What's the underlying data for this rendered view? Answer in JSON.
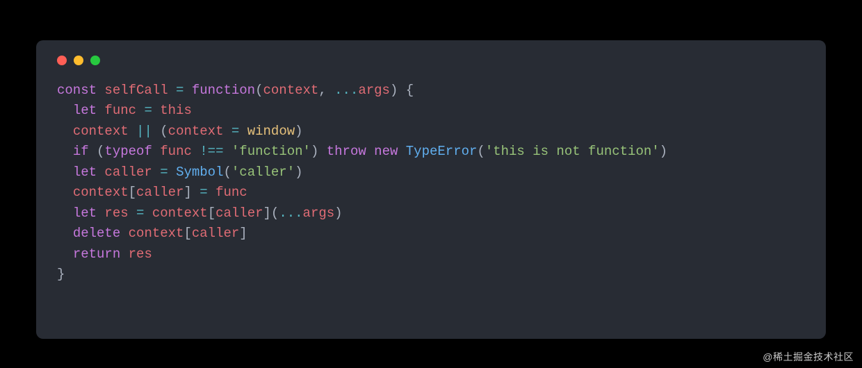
{
  "watermark": "@稀土掘金技术社区",
  "window": {
    "traffic": [
      "close",
      "minimize",
      "zoom"
    ]
  },
  "code": {
    "language": "javascript",
    "tokens": [
      [
        {
          "t": "const ",
          "c": "kw"
        },
        {
          "t": "selfCall",
          "c": "var"
        },
        {
          "t": " ",
          "c": "punc"
        },
        {
          "t": "=",
          "c": "op"
        },
        {
          "t": " ",
          "c": "punc"
        },
        {
          "t": "function",
          "c": "kw"
        },
        {
          "t": "(",
          "c": "punc"
        },
        {
          "t": "context",
          "c": "var"
        },
        {
          "t": ", ",
          "c": "punc"
        },
        {
          "t": "...",
          "c": "op"
        },
        {
          "t": "args",
          "c": "var"
        },
        {
          "t": ") {",
          "c": "punc"
        }
      ],
      [
        {
          "t": "  ",
          "c": "punc"
        },
        {
          "t": "let ",
          "c": "kw"
        },
        {
          "t": "func",
          "c": "var"
        },
        {
          "t": " ",
          "c": "punc"
        },
        {
          "t": "=",
          "c": "op"
        },
        {
          "t": " ",
          "c": "punc"
        },
        {
          "t": "this",
          "c": "var"
        }
      ],
      [
        {
          "t": "  ",
          "c": "punc"
        },
        {
          "t": "context",
          "c": "var"
        },
        {
          "t": " ",
          "c": "punc"
        },
        {
          "t": "||",
          "c": "op"
        },
        {
          "t": " (",
          "c": "punc"
        },
        {
          "t": "context",
          "c": "var"
        },
        {
          "t": " ",
          "c": "punc"
        },
        {
          "t": "=",
          "c": "op"
        },
        {
          "t": " ",
          "c": "punc"
        },
        {
          "t": "window",
          "c": "builtin"
        },
        {
          "t": ")",
          "c": "punc"
        }
      ],
      [
        {
          "t": "  ",
          "c": "punc"
        },
        {
          "t": "if ",
          "c": "kw"
        },
        {
          "t": "(",
          "c": "punc"
        },
        {
          "t": "typeof ",
          "c": "kw"
        },
        {
          "t": "func",
          "c": "var"
        },
        {
          "t": " ",
          "c": "punc"
        },
        {
          "t": "!==",
          "c": "op"
        },
        {
          "t": " ",
          "c": "punc"
        },
        {
          "t": "'function'",
          "c": "str"
        },
        {
          "t": ") ",
          "c": "punc"
        },
        {
          "t": "throw ",
          "c": "kw"
        },
        {
          "t": "new ",
          "c": "kw"
        },
        {
          "t": "TypeError",
          "c": "fn"
        },
        {
          "t": "(",
          "c": "punc"
        },
        {
          "t": "'this is not function'",
          "c": "str"
        },
        {
          "t": ")",
          "c": "punc"
        }
      ],
      [
        {
          "t": "  ",
          "c": "punc"
        },
        {
          "t": "let ",
          "c": "kw"
        },
        {
          "t": "caller",
          "c": "var"
        },
        {
          "t": " ",
          "c": "punc"
        },
        {
          "t": "=",
          "c": "op"
        },
        {
          "t": " ",
          "c": "punc"
        },
        {
          "t": "Symbol",
          "c": "fn"
        },
        {
          "t": "(",
          "c": "punc"
        },
        {
          "t": "'caller'",
          "c": "str"
        },
        {
          "t": ")",
          "c": "punc"
        }
      ],
      [
        {
          "t": "  ",
          "c": "punc"
        },
        {
          "t": "context",
          "c": "var"
        },
        {
          "t": "[",
          "c": "punc"
        },
        {
          "t": "caller",
          "c": "var"
        },
        {
          "t": "] ",
          "c": "punc"
        },
        {
          "t": "=",
          "c": "op"
        },
        {
          "t": " ",
          "c": "punc"
        },
        {
          "t": "func",
          "c": "var"
        }
      ],
      [
        {
          "t": "  ",
          "c": "punc"
        },
        {
          "t": "let ",
          "c": "kw"
        },
        {
          "t": "res",
          "c": "var"
        },
        {
          "t": " ",
          "c": "punc"
        },
        {
          "t": "=",
          "c": "op"
        },
        {
          "t": " ",
          "c": "punc"
        },
        {
          "t": "context",
          "c": "var"
        },
        {
          "t": "[",
          "c": "punc"
        },
        {
          "t": "caller",
          "c": "var"
        },
        {
          "t": "](",
          "c": "punc"
        },
        {
          "t": "...",
          "c": "op"
        },
        {
          "t": "args",
          "c": "var"
        },
        {
          "t": ")",
          "c": "punc"
        }
      ],
      [
        {
          "t": "  ",
          "c": "punc"
        },
        {
          "t": "delete ",
          "c": "kw"
        },
        {
          "t": "context",
          "c": "var"
        },
        {
          "t": "[",
          "c": "punc"
        },
        {
          "t": "caller",
          "c": "var"
        },
        {
          "t": "]",
          "c": "punc"
        }
      ],
      [
        {
          "t": "  ",
          "c": "punc"
        },
        {
          "t": "return ",
          "c": "kw"
        },
        {
          "t": "res",
          "c": "var"
        }
      ],
      [
        {
          "t": "}",
          "c": "punc"
        }
      ]
    ]
  }
}
